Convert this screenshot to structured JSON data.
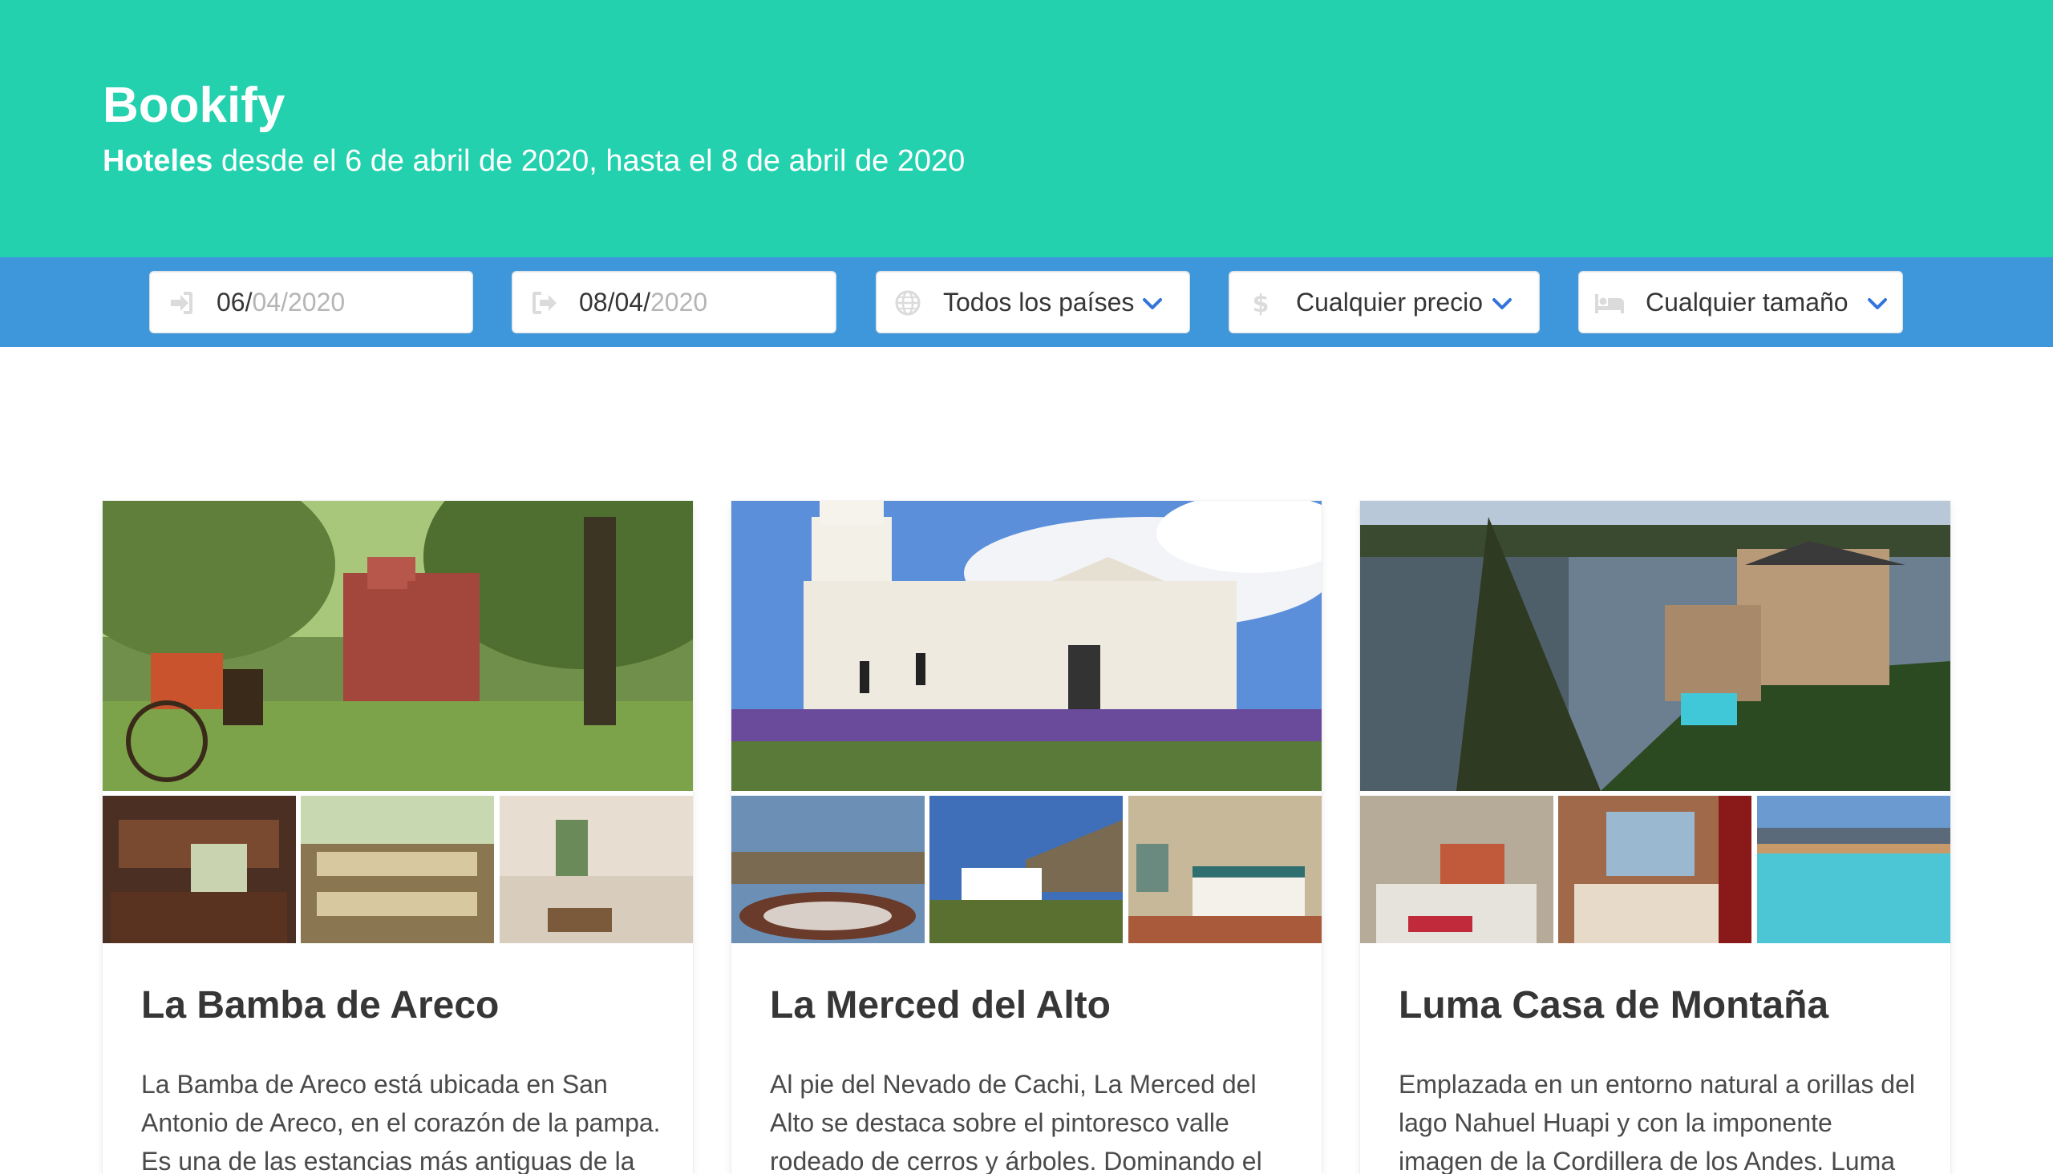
{
  "hero": {
    "title": "Bookify",
    "subtitle_strong": "Hoteles",
    "subtitle_rest": " desde el 6 de abril de 2020, hasta el 8 de abril de 2020"
  },
  "filters": {
    "date_from": {
      "day": "06/",
      "rest": "04/2020",
      "icon": "sign-in-icon"
    },
    "date_to": {
      "day_month": "08/04/",
      "year": "2020",
      "icon": "sign-out-icon"
    },
    "country": {
      "label": "Todos los países",
      "icon": "globe-icon"
    },
    "price": {
      "label": "Cualquier precio",
      "icon": "dollar-icon"
    },
    "size": {
      "label": "Cualquier tamaño",
      "icon": "bed-icon"
    }
  },
  "hotels": [
    {
      "name": "La Bamba de Areco",
      "description": "La Bamba de Areco está ubicada en San Antonio de Areco, en el corazón de la pampa. Es una de las estancias más antiguas de la"
    },
    {
      "name": "La Merced del Alto",
      "description": "Al pie del Nevado de Cachi, La Merced del Alto se destaca sobre el pintoresco valle rodeado de cerros y árboles. Dominando el valle"
    },
    {
      "name": "Luma Casa de Montaña",
      "description": "Emplazada en un entorno natural a orillas del lago Nahuel Huapi y con la imponente imagen de la Cordillera de los Andes. Luma Casa de"
    }
  ],
  "colors": {
    "hero_bg": "#23d1ae",
    "filter_bar_bg": "#3d97da",
    "chevron": "#3273dc"
  }
}
